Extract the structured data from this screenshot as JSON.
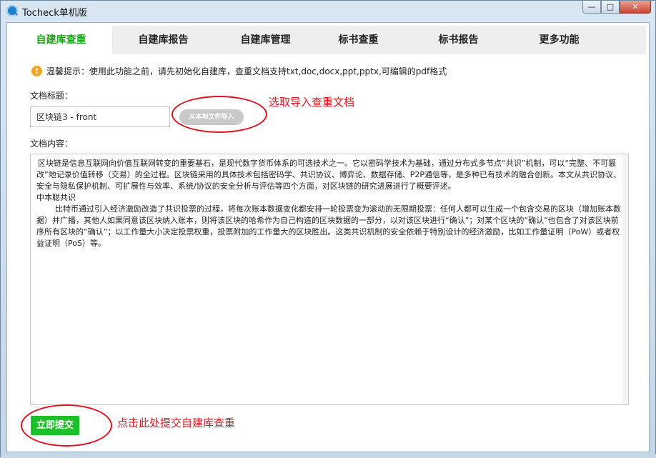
{
  "window": {
    "title": "Tocheck单机版",
    "min_symbol": "—",
    "max_symbol": "□",
    "close_symbol": "✕"
  },
  "tabs": [
    {
      "label": "自建库查重",
      "active": true
    },
    {
      "label": "自建库报告",
      "active": false
    },
    {
      "label": "自建库管理",
      "active": false
    },
    {
      "label": "标书查重",
      "active": false
    },
    {
      "label": "标书报告",
      "active": false
    },
    {
      "label": "更多功能",
      "active": false
    }
  ],
  "notice": {
    "icon_glyph": "!",
    "text": "温馨提示：使用此功能之前，请先初始化自建库，查重文档支持txt,doc,docx,ppt,pptx,可编辑的pdf格式"
  },
  "form": {
    "title_label": "文档标题：",
    "title_value": "区块链3 - front",
    "import_button": "从本地文件导入",
    "content_label": "文档内容：",
    "content_lines": [
      "区块链是信息互联网向价值互联网转变的重要基石，是现代数字货币体系的可选技术之一。它以密码学技术为基础，通过分布式多节点“共识”机制，可以“完整、不可篡改”地记录价值转移（交易）的全过程。区块链采用的具体技术包括密码学、共识协议、博弈论、数据存储、P2P通信等，是多种已有技术的融合创新。本文从共识协议、安全与隐私保护机制、可扩展性与效率、系统/协议的安全分析与评估等四个方面，对区块链的研究进展进行了概要评述。",
      "中本聪共识",
      "比特币通过引入经济激励改造了共识投票的过程，将每次账本数据变化都安排一轮投票变为滚动的无限期投票：任何人都可以生成一个包含交易的区块（增加账本数据）并广播，其他人如果同意该区块纳入账本，则将该区块的哈希作为自己构造的区块数据的一部分，以对该区块进行“确认”；对某个区块的“确认”也包含了对该区块前序所有区块的“确认”；以工作量大小决定投票权重，投票附加的工作量大的区块胜出。这类共识机制的安全依赖于特别设计的经济激励，比如工作量证明（PoW）或者权益证明（PoS）等。"
    ],
    "submit_button": "立即提交"
  },
  "annotations": {
    "import_hint": "选取导入查重文档",
    "submit_hint": "点击此处提交自建库查重"
  },
  "colors": {
    "accent_green": "#19a21a",
    "submit_green": "#1ec02a",
    "annotation_red": "#e0131f",
    "warning_orange": "#f5a623"
  }
}
